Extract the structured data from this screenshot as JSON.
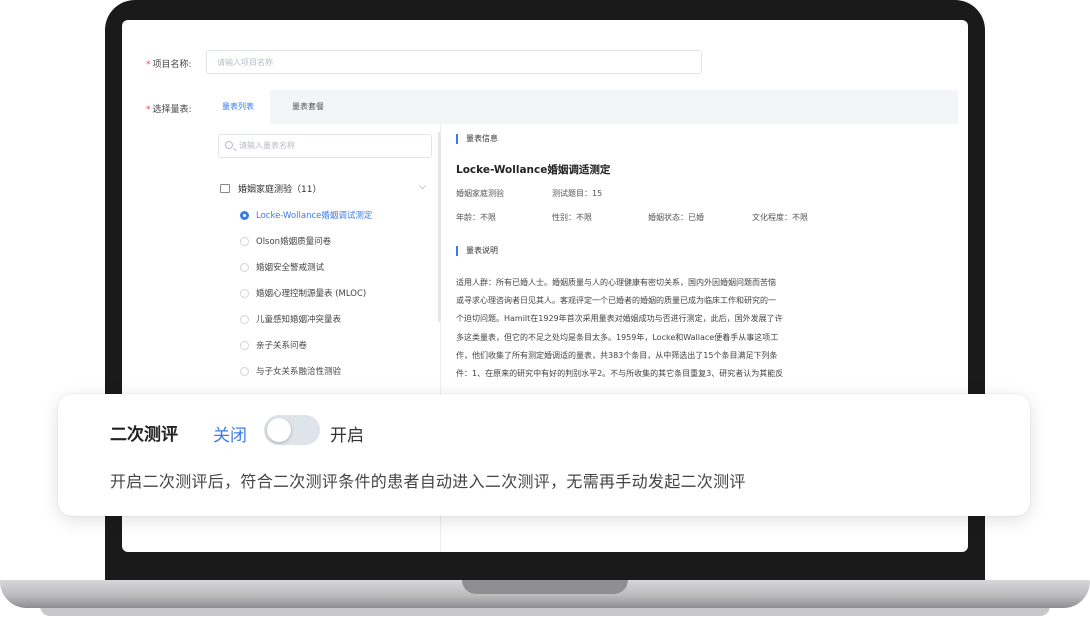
{
  "form": {
    "name_label": "项目名称:",
    "name_placeholder": "请输入项目名称",
    "scale_label": "选择量表:",
    "required_mark": "*"
  },
  "tabs": [
    {
      "label": "量表列表",
      "active": true
    },
    {
      "label": "量表套餐",
      "active": false
    }
  ],
  "left_panel": {
    "search_placeholder": "请输入量表名称",
    "group": {
      "label": "婚姻家庭测验（11）",
      "expanded": true
    },
    "items": [
      {
        "label": "Locke-Wollance婚姻调试测定",
        "selected": true
      },
      {
        "label": "Olson婚姻质量问卷",
        "selected": false
      },
      {
        "label": "婚姻安全警戒测试",
        "selected": false
      },
      {
        "label": "婚姻心理控制源量表 (MLOC)",
        "selected": false
      },
      {
        "label": "儿童感知婚姻冲突量表",
        "selected": false
      },
      {
        "label": "亲子关系问卷",
        "selected": false
      },
      {
        "label": "与子女关系融洽性测验",
        "selected": false
      }
    ]
  },
  "right_panel": {
    "info_head": "量表信息",
    "title": "Locke-Wollance婚姻调适测定",
    "category": "婚姻家庭测验",
    "question_count": "测试题目：15",
    "age": "年龄：不限",
    "gender": "性别：不限",
    "marital": "婚姻状态：已婚",
    "education": "文化程度：不限",
    "desc_head": "量表说明",
    "desc_lines": [
      "适用人群：所有已婚人士。婚姻质量与人的心理健康有密切关系，国内外因婚姻问题而苦恼",
      "或寻求心理咨询者日见其人。客观评定一个已婚者的婚姻的质量已成为临床工作和研究的一",
      "个迫切问题。Hamilt在1929年首次采用量表对婚姻成功与否进行测定，此后，国外发展了许",
      "多这类量表，但它的不足之处均是条目太多。1959年，Locke和Wallace便着手从事这项工",
      "作，他们收集了所有测定婚调适的量表，共383个条目，从中筛选出了15个条目满足下列条",
      "件：1、在原来的研究中有好的判别水平2。不与所收集的其它条目重复3、研究者认为其能反"
    ]
  },
  "overlay": {
    "title": "二次测评",
    "off_label": "关闭",
    "on_label": "开启",
    "toggle_on": false,
    "description": "开启二次测评后，符合二次测评条件的患者自动进入二次测评，无需再手动发起二次测评"
  },
  "colors": {
    "accent": "#3a7bea",
    "required": "#e34a4a",
    "bezel": "#1a1a1a"
  }
}
